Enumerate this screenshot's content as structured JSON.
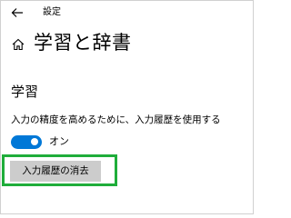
{
  "window": {
    "title": "設定",
    "back_icon": "arrow-left-icon"
  },
  "header": {
    "home_icon": "home-icon",
    "title": "学習と辞書"
  },
  "section": {
    "heading": "学習",
    "description": "入力の精度を高めるために、入力履歴を使用する",
    "toggle": {
      "state": "on",
      "label": "オン",
      "color": "#0078d7"
    },
    "clear_button_label": "入力履歴の消去"
  },
  "annotation": {
    "highlight_color": "#1fad3a"
  }
}
